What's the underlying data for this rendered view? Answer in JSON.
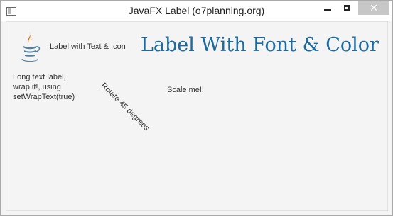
{
  "window": {
    "title": "JavaFX Label (o7planning.org)",
    "controls": {
      "minimize_icon": "minimize-icon",
      "maximize_icon": "maximize-icon",
      "close_glyph": "✕"
    }
  },
  "labels": {
    "icon_label": {
      "text": "Label with Text & Icon",
      "icon": "java-icon"
    },
    "font_color_label": {
      "text": "Label With Font & Color",
      "color": "#1b6aa0"
    },
    "wrap_label": {
      "text": "Long text label, wrap it!, using setWrapText(true)"
    },
    "rotate_label": {
      "text": "Rotate 45 degrees",
      "rotation_degrees": 45
    },
    "scale_label": {
      "text": "Scale me!!"
    }
  }
}
